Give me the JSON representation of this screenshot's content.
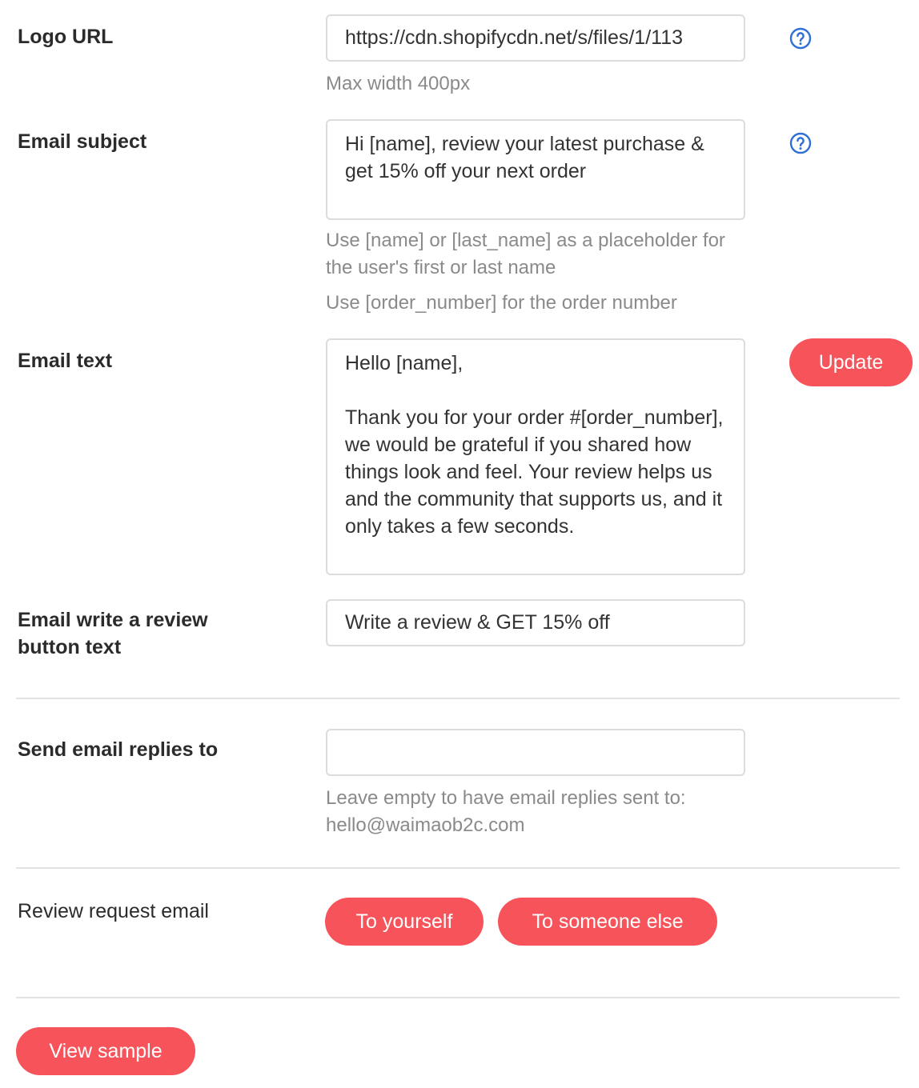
{
  "logo_url": {
    "label": "Logo URL",
    "value": "https://cdn.shopifycdn.net/s/files/1/113",
    "hint": "Max width 400px",
    "help_icon": "question-circle-icon"
  },
  "email_subject": {
    "label": "Email subject",
    "value": "Hi [name], review your latest purchase & get 15% off your next order",
    "hint_1": "Use [name] or [last_name] as a placeholder for the user's first or last name",
    "hint_2": "Use [order_number] for the order number",
    "help_icon": "question-circle-icon"
  },
  "email_text": {
    "label": "Email text",
    "value": "Hello [name],\n\nThank you for your order #[order_number], we would be grateful if you shared how things look and feel. Your review helps us and the community that supports us, and it only takes a few seconds.",
    "update_label": "Update"
  },
  "review_button_text": {
    "label": "Email write a review button text",
    "value": "Write a review & GET 15% off"
  },
  "replies": {
    "label": "Send email replies to",
    "value": "",
    "hint": "Leave empty to have email replies sent to: hello@waimaob2c.com"
  },
  "review_request": {
    "label": "Review request email",
    "to_yourself_label": "To yourself",
    "to_someone_else_label": "To someone else"
  },
  "view_sample_label": "View sample",
  "colors": {
    "accent": "#f7535a",
    "help_icon": "#2f6fd6",
    "hint_text": "#8a8a8a",
    "border": "#dcdcdc"
  }
}
